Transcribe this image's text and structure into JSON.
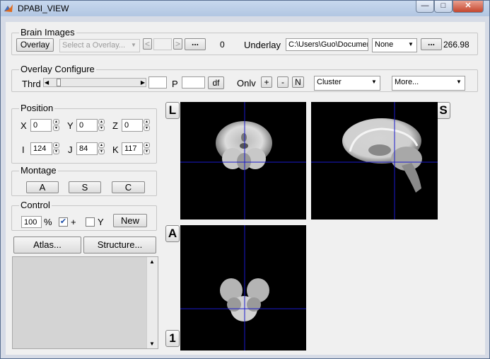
{
  "window": {
    "title": "DPABI_VIEW"
  },
  "brain_images": {
    "legend": "Brain Images",
    "overlay_button": "Overlay",
    "overlay_select": "Select a Overlay...",
    "prev_button": "<",
    "index_value": "",
    "next_button": ">",
    "browse_button": "...",
    "overlay_count": "0",
    "underlay_label": "Underlay",
    "underlay_path": "C:\\Users\\Guo\\Documen",
    "underlay_select": "None",
    "underlay_browse": "...",
    "underlay_max": "266.98"
  },
  "overlay_configure": {
    "legend": "Overlay Configure",
    "thrd_label": "Thrd",
    "thrd_value": "",
    "p_label": "P",
    "p_value": "",
    "df_button": "df",
    "onlv_label": "Onlv",
    "plus_button": "+",
    "minus_button": "-",
    "n_button": "N",
    "cluster_select": "Cluster",
    "more_select": "More..."
  },
  "position": {
    "legend": "Position",
    "x_label": "X",
    "x_value": "0",
    "y_label": "Y",
    "y_value": "0",
    "z_label": "Z",
    "z_value": "0",
    "i_label": "I",
    "i_value": "124",
    "j_label": "J",
    "j_value": "84",
    "k_label": "K",
    "k_value": "117"
  },
  "montage": {
    "legend": "Montage",
    "a_button": "A",
    "s_button": "S",
    "c_button": "C"
  },
  "control": {
    "legend": "Control",
    "percent_value": "100",
    "percent_label": "%",
    "plus_checked": true,
    "plus_label": "+",
    "y_checked": false,
    "y_label": "Y",
    "new_button": "New"
  },
  "atlas_button": "Atlas...",
  "structure_button": "Structure...",
  "views": {
    "coronal_label": "L",
    "sagittal_label": "S",
    "axial_label": "A",
    "slice_label": "1"
  },
  "colors": {
    "crosshair": "#1a1acc",
    "background": "#f0f0f0"
  }
}
